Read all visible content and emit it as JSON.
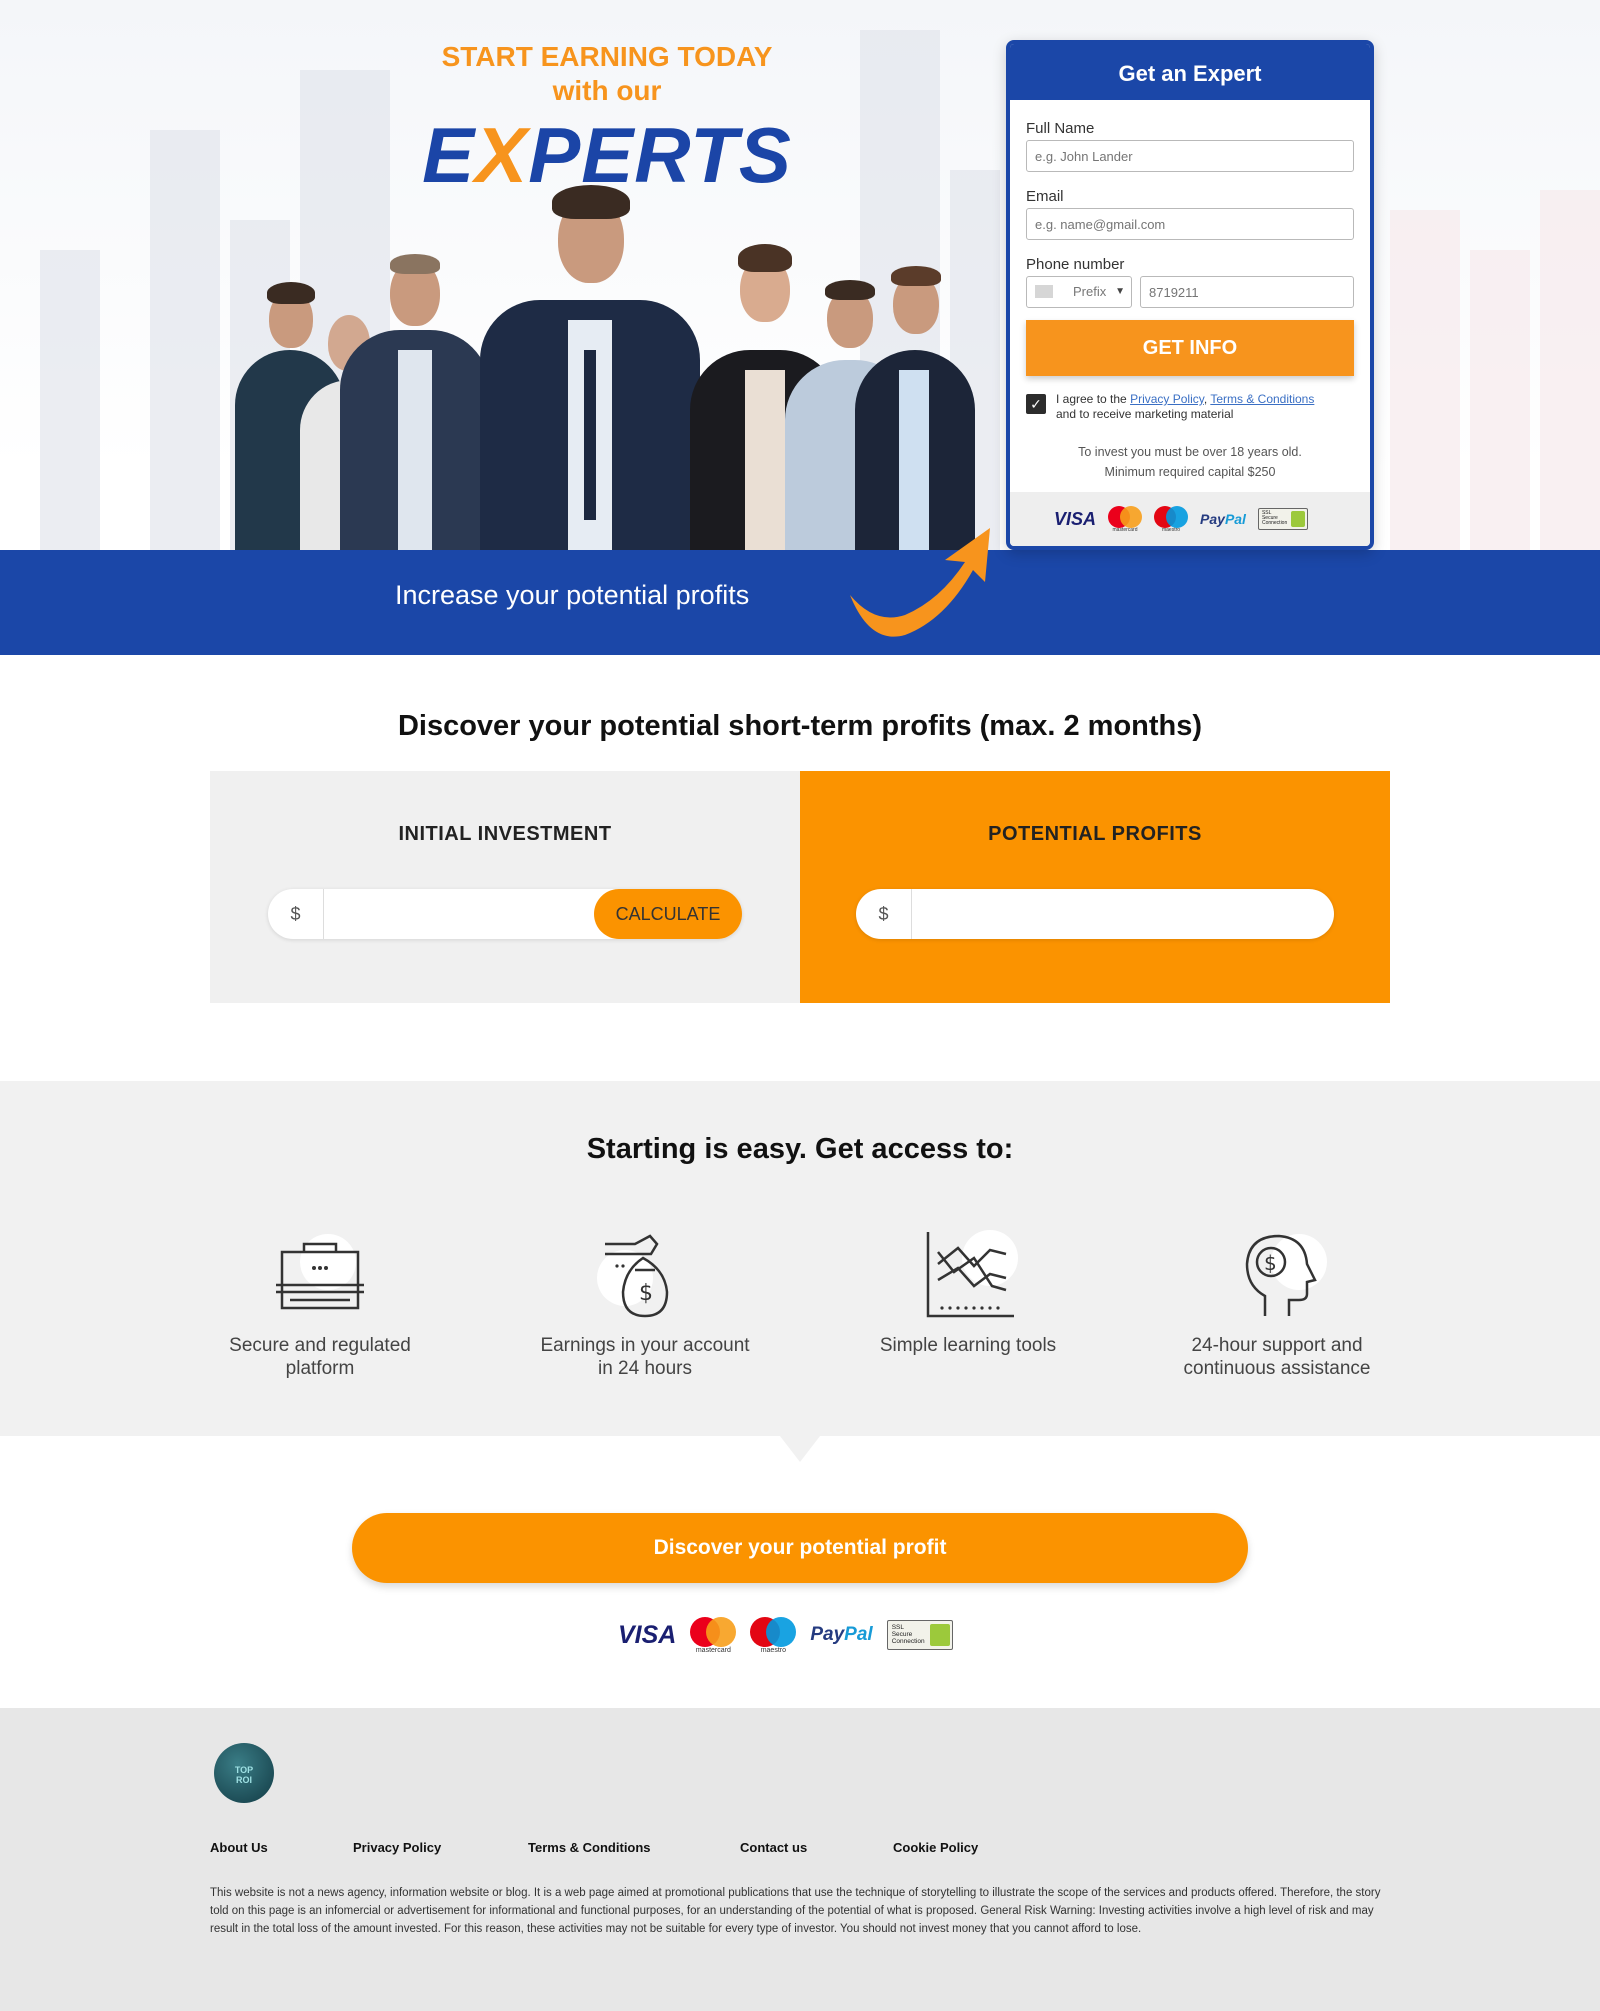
{
  "hero": {
    "headline_line1": "START EARNING TODAY",
    "headline_line2": "with our",
    "brand_pre": "E",
    "brand_x": "X",
    "brand_post": "PERTS",
    "band_text": "Increase your potential profits"
  },
  "form": {
    "title": "Get an Expert",
    "full_name_label": "Full Name",
    "full_name_placeholder": "e.g. John Lander",
    "email_label": "Email",
    "email_placeholder": "e.g. name@gmail.com",
    "phone_label": "Phone number",
    "prefix_label": "Prefix",
    "phone_placeholder": "8719211",
    "submit_label": "GET INFO",
    "agree_prefix": "I agree to the ",
    "privacy_link": "Privacy Policy",
    "agree_sep": ", ",
    "terms_link": "Terms & Conditions",
    "agree_suffix": "and to receive marketing material",
    "agree_checked": true,
    "notice_line1": "To invest you must be over 18 years old.",
    "notice_line2": "Minimum required capital $250"
  },
  "payments": {
    "visa": "VISA",
    "mastercard": "mastercard",
    "maestro": "maestro",
    "paypal_pay": "Pay",
    "paypal_pal": "Pal",
    "ssl_line1": "SSL",
    "ssl_line2": "Secure",
    "ssl_line3": "Connection"
  },
  "calculator": {
    "title": "Discover your potential short-term profits (max. 2 months)",
    "investment_label": "INITIAL INVESTMENT",
    "profits_label": "POTENTIAL PROFITS",
    "currency": "$",
    "calculate_label": "CALCULATE",
    "investment_value": "",
    "profits_value": ""
  },
  "features": {
    "title": "Starting is easy. Get access to:",
    "items": [
      {
        "label_l1": "Secure and regulated",
        "label_l2": "platform",
        "icon": "briefcase-icon"
      },
      {
        "label_l1": "Earnings in your account",
        "label_l2": "in 24 hours",
        "icon": "money-bag-icon"
      },
      {
        "label_l1": "Simple learning tools",
        "label_l2": "",
        "icon": "chart-icon"
      },
      {
        "label_l1": "24-hour support and",
        "label_l2": "continuous assistance",
        "icon": "head-dollar-icon"
      }
    ]
  },
  "cta": {
    "label": "Discover your potential profit"
  },
  "footer": {
    "logo_line1": "TOP",
    "logo_line2": "ROI",
    "links": [
      "About Us",
      "Privacy Policy",
      "Terms & Conditions",
      "Contact us",
      "Cookie Policy"
    ],
    "disclaimer": "This website is not a news agency, information website or blog. It is a web page aimed at promotional publications that use the technique of storytelling to illustrate the scope of the services and products offered. Therefore, the story told on this page is an infomercial or advertisement for informational and functional purposes, for an understanding of the potential of what is proposed. General Risk Warning: Investing activities involve a high level of risk and may result in the total loss of the amount invested. For this reason, these activities may not be suitable for every type of investor. You should not invest money that you cannot afford to lose."
  },
  "colors": {
    "brand_blue": "#1b47a8",
    "accent_orange": "#fb9300",
    "headline_orange": "#f7941d"
  }
}
